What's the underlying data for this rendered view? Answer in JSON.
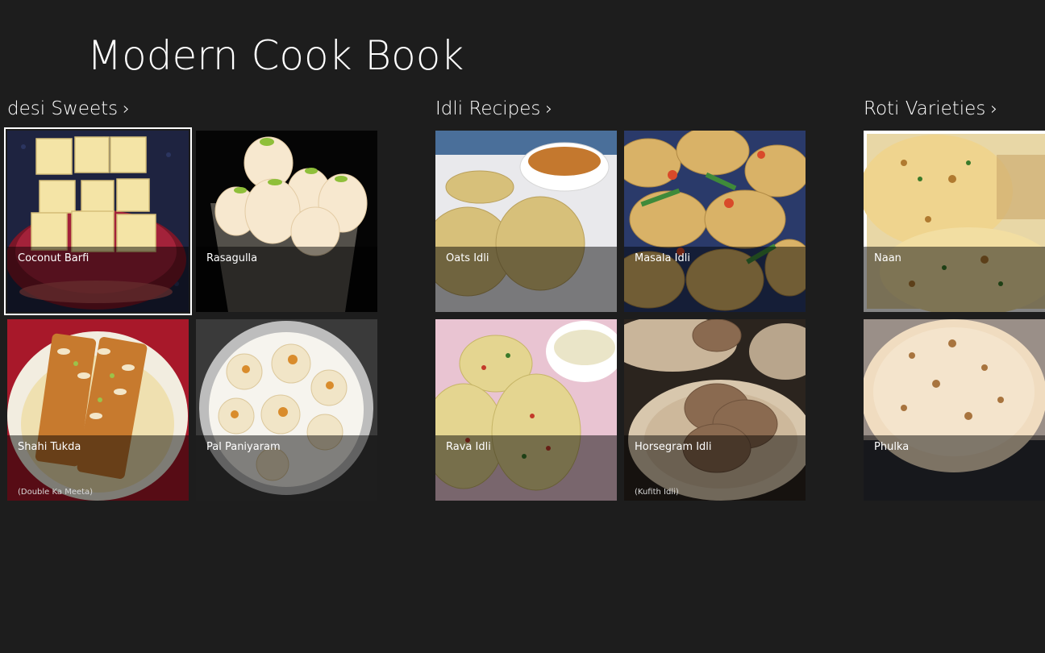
{
  "app": {
    "title": "Modern Cook Book"
  },
  "groups": [
    {
      "title": "desi Sweets",
      "chevron": "›",
      "tiles": [
        {
          "name": "Coconut Barfi",
          "subtitle": "",
          "icon": "coconut-barfi-image"
        },
        {
          "name": "Rasagulla",
          "subtitle": "",
          "icon": "rasagulla-image"
        },
        {
          "name": "Shahi Tukda",
          "subtitle": "(Double Ka Meeta)",
          "icon": "shahi-tukda-image"
        },
        {
          "name": "Pal Paniyaram",
          "subtitle": "",
          "icon": "pal-paniyaram-image"
        }
      ]
    },
    {
      "title": "Idli Recipes",
      "chevron": "›",
      "tiles": [
        {
          "name": "Oats Idli",
          "subtitle": "",
          "icon": "oats-idli-image"
        },
        {
          "name": "Masala Idli",
          "subtitle": "",
          "icon": "masala-idli-image"
        },
        {
          "name": "Rava Idli",
          "subtitle": "",
          "icon": "rava-idli-image"
        },
        {
          "name": "Horsegram Idli",
          "subtitle": "(Kufith Idli)",
          "icon": "horsegram-idli-image"
        }
      ]
    },
    {
      "title": "Roti Varieties",
      "chevron": "›",
      "tiles": [
        {
          "name": "Naan",
          "subtitle": "",
          "icon": "naan-image"
        },
        {
          "name": "Phulka",
          "subtitle": "",
          "icon": "phulka-image"
        }
      ]
    }
  ],
  "selected_tile": "Coconut Barfi",
  "colors": {
    "background": "#1d1d1d",
    "text": "#ffffff",
    "overlay": "rgba(0,0,0,0.48)"
  }
}
